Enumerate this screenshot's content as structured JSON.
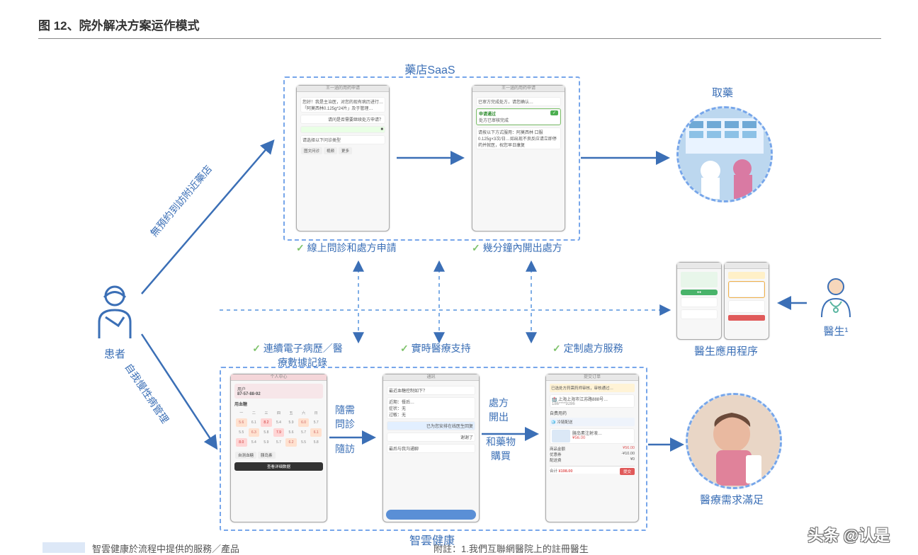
{
  "title": "图 12、院外解决方案运作模式",
  "patient_label": "患者",
  "diag_upper": "無預約到訪附近藥店",
  "diag_lower": "自我慢性病管理",
  "pharmacy_saas": {
    "title": "藥店SaaS",
    "cap1": "線上問診和處方申請",
    "cap2": "幾分鐘內開出處方",
    "phone_header": "王一涵的用药申请"
  },
  "app_labels": {
    "doctor_app": "醫生應用程序",
    "doctor": "醫生¹"
  },
  "outcomes": {
    "pickup": "取藥",
    "need_met": "醫療需求滿足"
  },
  "cloud": {
    "title": "智雲健康",
    "cap1_l1": "連續電子病歷／醫",
    "cap1_l2": "療數據記錄",
    "cap2": "實時醫療支持",
    "cap3": "定制處方服務",
    "mid1_l1": "隨需",
    "mid1_l2": "問診",
    "mid1_l3": "隨訪",
    "mid2_l1": "處方",
    "mid2_l2": "開出",
    "mid2_l3": "和藥物",
    "mid2_l4": "購買"
  },
  "footnote_legend": "智雲健康於流程中提供的服務／產品",
  "footnote_note": "附註：1.我們互聯網醫院上的註冊醫生",
  "watermark": "头条 @认是"
}
